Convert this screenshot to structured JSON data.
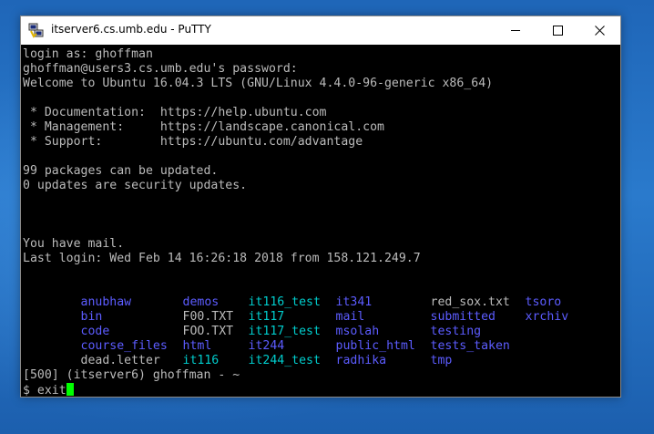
{
  "window": {
    "title": "itserver6.cs.umb.edu - PuTTY",
    "icon": "putty-icon",
    "controls": {
      "minimize": "minimize-icon",
      "maximize": "maximize-icon",
      "close": "close-icon"
    }
  },
  "colors": {
    "terminal_bg": "#000000",
    "terminal_text": "#bbbbbb",
    "directory": "#5c5cff",
    "executable": "#00cdcd",
    "cursor": "#00ff00"
  },
  "terminal": {
    "login_as": "login as: ghoffman",
    "password_prompt": "ghoffman@users3.cs.umb.edu's password:",
    "welcome": "Welcome to Ubuntu 16.04.3 LTS (GNU/Linux 4.4.0-96-generic x86_64)",
    "doc_line": " * Documentation:  https://help.ubuntu.com",
    "mgmt_line": " * Management:     https://landscape.canonical.com",
    "support_line": " * Support:        https://ubuntu.com/advantage",
    "packages_line": "99 packages can be updated.",
    "security_line": "0 updates are security updates.",
    "mail_line": "You have mail.",
    "last_login": "Last login: Wed Feb 14 16:26:18 2018 from 158.121.249.7",
    "listing": [
      [
        "anubhaw",
        "demos",
        "it116_test",
        "it341",
        "red_sox.txt",
        "tsoro"
      ],
      [
        "bin",
        "F00.TXT",
        "it117",
        "mail",
        "submitted",
        "xrchiv"
      ],
      [
        "code",
        "FOO.TXT",
        "it117_test",
        "msolah",
        "testing",
        ""
      ],
      [
        "course_files",
        "html",
        "it244",
        "public_html",
        "tests_taken",
        ""
      ],
      [
        "dead.letter",
        "it116",
        "it244_test",
        "radhika",
        "tmp",
        ""
      ]
    ],
    "prompt_info": "[500] (itserver6) ghoffman - ~",
    "prompt": "$ exit"
  }
}
